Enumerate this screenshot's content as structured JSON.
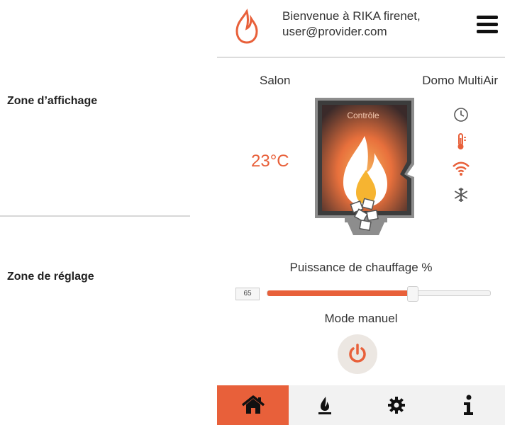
{
  "annotations": {
    "display_zone": "Zone d’affichage",
    "setting_zone": "Zone de réglage"
  },
  "header": {
    "welcome_line1": "Bienvenue à RIKA firenet,",
    "welcome_line2": "user@provider.com"
  },
  "status": {
    "room": "Salon",
    "stove_model": "Domo MultiAir",
    "temperature": "23°C",
    "stove_label": "Contrôle"
  },
  "status_icons": [
    "clock-icon",
    "thermometer-icon",
    "wifi-icon",
    "snowflake-icon"
  ],
  "power": {
    "label": "Puissance de chauffage %",
    "value": "65",
    "percent": 65
  },
  "mode": {
    "label": "Mode manuel"
  },
  "tabs": [
    {
      "icon": "home-icon",
      "active": true
    },
    {
      "icon": "flame-icon",
      "active": false
    },
    {
      "icon": "gear-icon",
      "active": false
    },
    {
      "icon": "info-icon",
      "active": false
    }
  ],
  "colors": {
    "accent": "#e8603a",
    "text": "#333333",
    "tabbar": "#f2f2f2"
  }
}
